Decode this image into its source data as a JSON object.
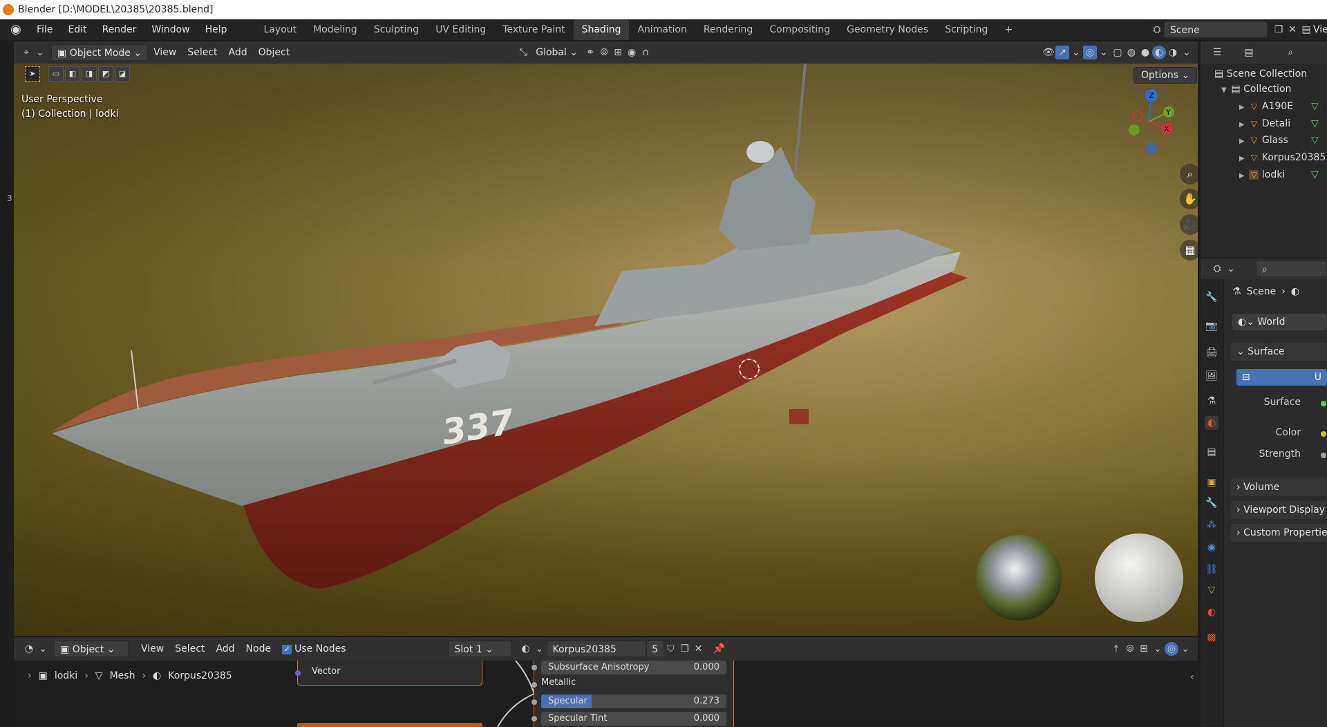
{
  "window": {
    "title": "Blender [D:\\MODEL\\20385\\20385.blend]"
  },
  "menu": {
    "items": [
      "File",
      "Edit",
      "Render",
      "Window",
      "Help"
    ],
    "workspaces": [
      "Layout",
      "Modeling",
      "Sculpting",
      "UV Editing",
      "Texture Paint",
      "Shading",
      "Animation",
      "Rendering",
      "Compositing",
      "Geometry Nodes",
      "Scripting"
    ],
    "active_workspace": "Shading",
    "add_tab": "+",
    "scene_name": "Scene",
    "view_layer": "Vie"
  },
  "viewport_header": {
    "mode": "Object Mode",
    "items": [
      "View",
      "Select",
      "Add",
      "Object"
    ],
    "orientation": "Global"
  },
  "viewport": {
    "perspective": "User Perspective",
    "collection_info": "(1) Collection | lodki",
    "options": "Options",
    "gizmo": {
      "z": "Z",
      "y": "Y",
      "x": "X"
    },
    "hull_number": "337",
    "nav_icons": [
      "zoom-icon",
      "hand-pan-icon",
      "camera-icon",
      "grid-icon"
    ]
  },
  "node_editor": {
    "editor_type": "Object",
    "items": [
      "View",
      "Select",
      "Add",
      "Node"
    ],
    "use_nodes_label": "Use Nodes",
    "use_nodes_checked": true,
    "slot": "Slot 1",
    "material": "Korpus20385",
    "user_count": "5",
    "breadcrumbs": [
      "lodki",
      "Mesh",
      "Korpus20385"
    ],
    "vector_label": "Vector",
    "rows": [
      {
        "label": "Subsurface Anisotropy",
        "value": "0.000"
      },
      {
        "label": "Metallic",
        "value": ""
      },
      {
        "label": "Specular",
        "value": "0.273"
      },
      {
        "label": "Specular Tint",
        "value": "0.000"
      }
    ],
    "specular_fill": 0.273
  },
  "outliner": {
    "root": "Scene Collection",
    "collection": "Collection",
    "objects": [
      "A190E",
      "Detali",
      "Glass",
      "Korpus20385",
      "lodki"
    ]
  },
  "properties": {
    "breadcrumb_scene": "Scene",
    "world": "World",
    "surface_panel": "Surface",
    "use_btn": "U",
    "fields": [
      {
        "label": "Surface"
      },
      {
        "label": "Color"
      },
      {
        "label": "Strength"
      }
    ],
    "collapsed_panels": [
      "Volume",
      "Viewport Display",
      "Custom Propertie"
    ]
  },
  "left_margin_numbers": [
    "3"
  ],
  "colors": {
    "accent_blue": "#4772b3",
    "orange": "#e87d0d",
    "hull_red": "#8b2a1c"
  }
}
